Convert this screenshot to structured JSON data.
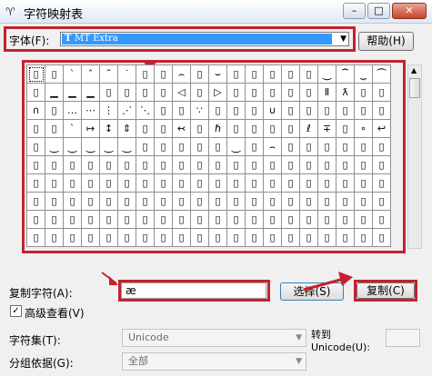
{
  "window": {
    "title": "字符映射表",
    "app_icon": "char-map-icon",
    "minimize": "–",
    "maximize": "□",
    "close": "✕"
  },
  "font_row": {
    "label": "字体(F):",
    "selected_font": "MT Extra",
    "font_type_glyph": "T",
    "help_button": "帮助(H)"
  },
  "grid": {
    "rows": [
      [
        "▯",
        "▯",
        "`",
        "ˆ",
        "˜",
        "˙",
        "▯",
        "▯",
        "⌢",
        "▯",
        "⌣",
        "▯",
        "▯",
        "▯",
        "▯",
        "▯",
        "⏝",
        "⏞",
        "⏟",
        "⏜"
      ],
      [
        "▯",
        "▁",
        "▁",
        "▁",
        "▯",
        "▯",
        "▯",
        "▯",
        "◁",
        "▯",
        "▷",
        "▯",
        "▯",
        "▯",
        "▯",
        "▯",
        "Ⅱ",
        "ƛ",
        "▯",
        "▯"
      ],
      [
        "∩",
        "▯",
        "…",
        "⋯",
        "⋮",
        "⋰",
        "⋱",
        "▯",
        "▯",
        "∵",
        "▯",
        "▯",
        "▯",
        "∪",
        "▯",
        "▯",
        "▯",
        "▯",
        "▯",
        "▯"
      ],
      [
        "▯",
        "▯",
        "`",
        "↦",
        "↕",
        "⇕",
        "▯",
        "▯",
        "↢",
        "▯",
        "ℏ",
        "▯",
        "▯",
        "▯",
        "▯",
        "ℓ",
        "∓",
        "▯",
        "∘",
        "↩"
      ],
      [
        "▯",
        "⏝",
        "⏝",
        "⏝",
        "⏝",
        "⏝",
        "▯",
        "▯",
        "▯",
        "▯",
        "▯",
        "⏝",
        "▯",
        "⌢",
        "▯",
        "▯",
        "▯",
        "▯",
        "▯",
        "▯"
      ],
      [
        "▯",
        "▯",
        "▯",
        "▯",
        "▯",
        "▯",
        "▯",
        "▯",
        "▯",
        "▯",
        "▯",
        "▯",
        "▯",
        "▯",
        "▯",
        "▯",
        "▯",
        "▯",
        "▯",
        "▯"
      ],
      [
        "▯",
        "▯",
        "▯",
        "▯",
        "▯",
        "▯",
        "▯",
        "▯",
        "▯",
        "▯",
        "▯",
        "▯",
        "▯",
        "▯",
        "▯",
        "▯",
        "▯",
        "▯",
        "▯",
        "▯"
      ],
      [
        "▯",
        "▯",
        "▯",
        "▯",
        "▯",
        "▯",
        "▯",
        "▯",
        "▯",
        "▯",
        "▯",
        "▯",
        "▯",
        "▯",
        "▯",
        "▯",
        "▯",
        "▯",
        "▯",
        "▯"
      ],
      [
        "▯",
        "▯",
        "▯",
        "▯",
        "▯",
        "▯",
        "▯",
        "▯",
        "▯",
        "▯",
        "▯",
        "▯",
        "▯",
        "▯",
        "▯",
        "▯",
        "▯",
        "▯",
        "▯",
        "▯"
      ],
      [
        "▯",
        "▯",
        "▯",
        "▯",
        "▯",
        "▯",
        "▯",
        "▯",
        "▯",
        "▯",
        "▯",
        "▯",
        "▯",
        "▯",
        "▯",
        "▯",
        "▯",
        "▯",
        "▯",
        "▯"
      ]
    ]
  },
  "copy_row": {
    "label": "复制字符(A):",
    "value": "æ",
    "select_button": "选择(S)",
    "copy_button": "复制(C)"
  },
  "advanced": {
    "label": "高级查看(V)",
    "checked": true
  },
  "charset_row": {
    "label": "字符集(T):",
    "value": "Unicode",
    "goto_label_1": "转到",
    "goto_label_2": "Unicode(U):",
    "goto_value": ""
  },
  "group_row": {
    "label": "分组依据(G):",
    "value": "全部"
  },
  "colors": {
    "highlight_red": "#c3232e",
    "selection_blue": "#3399ff"
  }
}
